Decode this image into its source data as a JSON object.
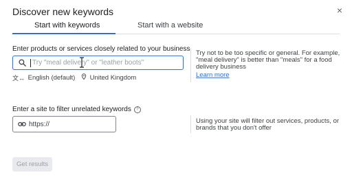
{
  "dialog": {
    "title": "Discover new keywords",
    "close_glyph": "×"
  },
  "tabs": [
    {
      "label": "Start with keywords",
      "active": true
    },
    {
      "label": "Start with a website",
      "active": false
    }
  ],
  "keywords": {
    "label": "Enter products or services closely related to your business",
    "input_value": "",
    "placeholder": "Try \"meal delivery\" or \"leather boots\"",
    "language_icon": "translate-icon",
    "language": "English (default)",
    "location_icon": "location-pin-icon",
    "location": "United Kingdom",
    "hint": "Try not to be too specific or general. For example, \"meal delivery\" is better than \"meals\" for a food delivery business",
    "learn_more": "Learn more"
  },
  "site": {
    "label": "Enter a site to filter unrelated keywords",
    "help_glyph": "?",
    "input_value": "",
    "placeholder": "https://",
    "hint": "Using your site will filter out services, products, or brands that you don't offer"
  },
  "actions": {
    "get_results": "Get results"
  },
  "colors": {
    "accent": "#1a73e8",
    "text": "#202124",
    "muted": "#5f6368",
    "disabled_bg": "#e8eaed",
    "disabled_text": "#9aa0a6"
  }
}
